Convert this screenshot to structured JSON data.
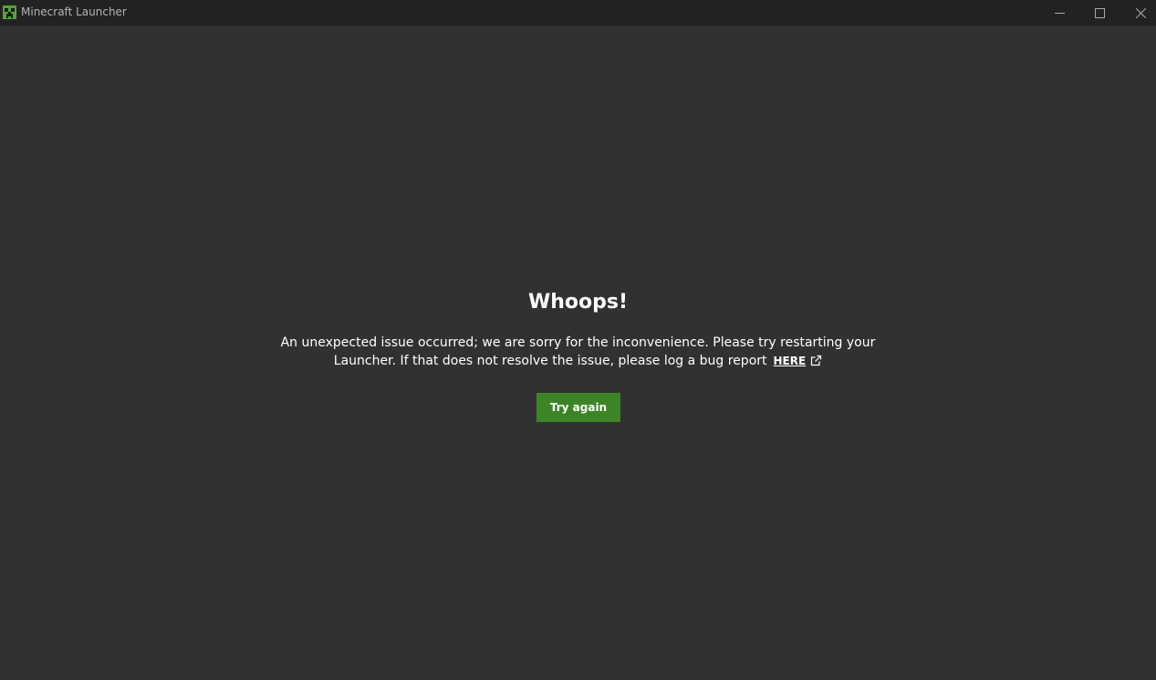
{
  "window": {
    "title": "Minecraft Launcher",
    "app_icon": "creeper-icon",
    "controls": {
      "minimize_icon": "minimize-icon",
      "maximize_icon": "maximize-icon",
      "close_icon": "close-icon"
    }
  },
  "error": {
    "heading": "Whoops!",
    "message_part1": "An unexpected issue occurred; we are sorry for the inconvenience. Please try restarting your Launcher. If that does not resolve the issue, please log a bug report",
    "link_label": "HERE",
    "link_icon": "external-link-icon",
    "retry_label": "Try again"
  },
  "colors": {
    "background": "#313131",
    "titlebar": "#222222",
    "accent_green": "#3c8527",
    "text": "#ffffff"
  }
}
